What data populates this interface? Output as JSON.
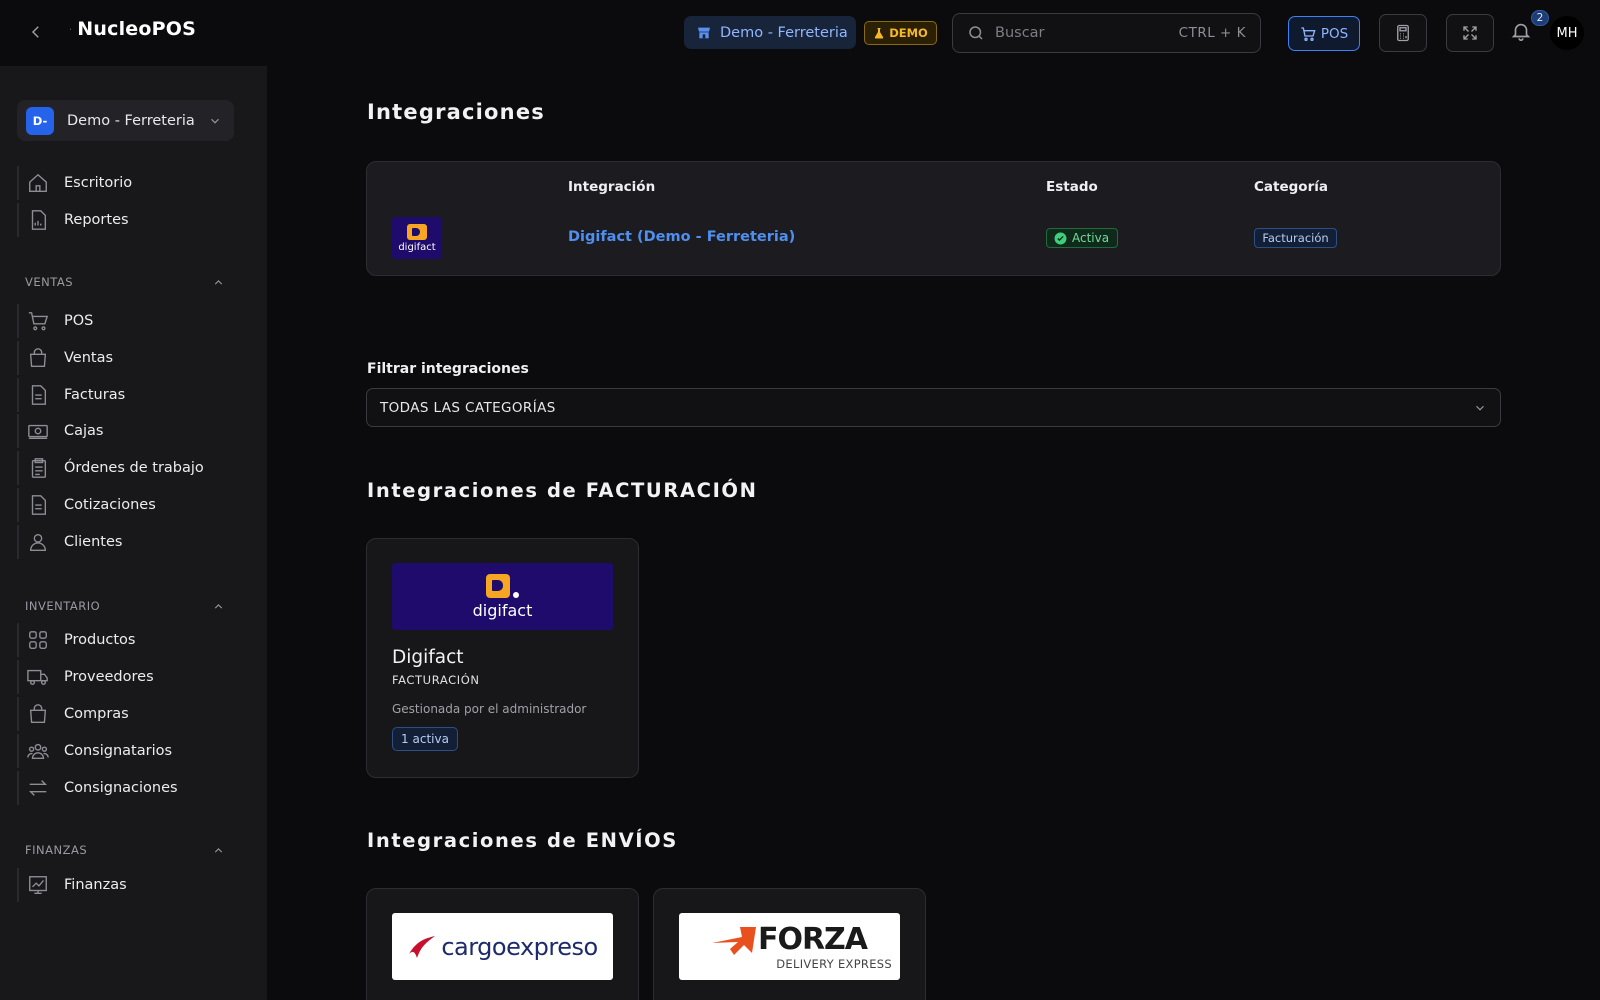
{
  "topbar": {
    "brand": "NucleoPOS",
    "store_name": "Demo - Ferreteria",
    "demo_label": "DEMO",
    "search": {
      "placeholder": "Buscar",
      "shortcut": "CTRL + K"
    },
    "pos_label": "POS",
    "notifications_count": "2",
    "avatar_initials": "MH",
    "colors": {
      "accent": "#3b82f6",
      "demo": "#f4b82a"
    }
  },
  "sidebar": {
    "org": {
      "initials": "D-",
      "name": "Demo - Ferreteria"
    },
    "top_items": [
      {
        "label": "Escritorio",
        "icon": "home-icon"
      },
      {
        "label": "Reportes",
        "icon": "report-icon"
      }
    ],
    "sections": [
      {
        "title": "VENTAS",
        "items": [
          {
            "label": "POS",
            "icon": "cart-icon"
          },
          {
            "label": "Ventas",
            "icon": "bag-icon"
          },
          {
            "label": "Facturas",
            "icon": "document-icon"
          },
          {
            "label": "Cajas",
            "icon": "cash-icon"
          },
          {
            "label": "Órdenes de trabajo",
            "icon": "clipboard-icon"
          },
          {
            "label": "Cotizaciones",
            "icon": "document-icon"
          },
          {
            "label": "Clientes",
            "icon": "user-icon"
          }
        ]
      },
      {
        "title": "INVENTARIO",
        "items": [
          {
            "label": "Productos",
            "icon": "grid-icon"
          },
          {
            "label": "Proveedores",
            "icon": "truck-icon"
          },
          {
            "label": "Compras",
            "icon": "bag-icon"
          },
          {
            "label": "Consignatarios",
            "icon": "users-icon"
          },
          {
            "label": "Consignaciones",
            "icon": "arrows-icon"
          }
        ]
      },
      {
        "title": "FINANZAS",
        "items": [
          {
            "label": "Finanzas",
            "icon": "chart-icon"
          }
        ]
      }
    ]
  },
  "main": {
    "title": "Integraciones",
    "table": {
      "headers": [
        "Integración",
        "Estado",
        "Categoría"
      ],
      "rows": [
        {
          "logo_text": "digifact",
          "name": "Digifact (Demo - Ferreteria)",
          "status": "Activa",
          "category": "Facturación"
        }
      ]
    },
    "filter": {
      "label": "Filtrar integraciones",
      "value": "TODAS LAS CATEGORÍAS"
    },
    "groups": [
      {
        "title": "Integraciones de FACTURACIÓN",
        "cards": [
          {
            "logo_text": "digifact",
            "title": "Digifact",
            "category": "FACTURACIÓN",
            "managed": "Gestionada por el administrador",
            "count": "1 activa"
          }
        ]
      },
      {
        "title": "Integraciones de ENVÍOS",
        "cards": [
          {
            "logo_text": "cargoexpreso"
          },
          {
            "logo_text": "FORZA",
            "logo_subtext": "DELIVERY EXPRESS"
          }
        ]
      }
    ]
  }
}
